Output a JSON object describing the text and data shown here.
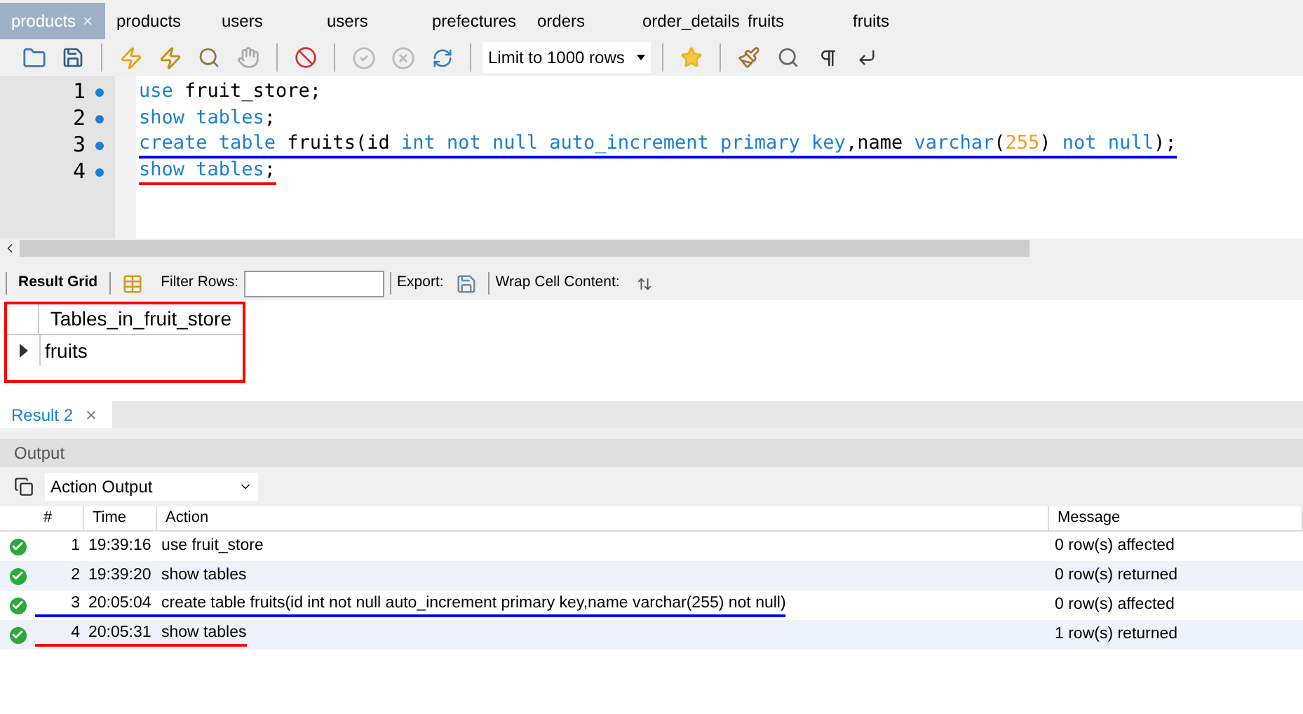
{
  "tabs": [
    {
      "label": "products",
      "selected": true,
      "closable": true
    },
    {
      "label": "products",
      "selected": false
    },
    {
      "label": "users",
      "selected": false
    },
    {
      "label": "users",
      "selected": false
    },
    {
      "label": "prefectures",
      "selected": false
    },
    {
      "label": "orders",
      "selected": false
    },
    {
      "label": "order_details",
      "selected": false
    },
    {
      "label": "fruits",
      "selected": false
    },
    {
      "label": "fruits",
      "selected": false
    }
  ],
  "toolbar": {
    "limit_select": "Limit to 1000 rows"
  },
  "editor": {
    "lines": [
      {
        "number": "1",
        "tokens": [
          {
            "text": "use",
            "kind": "keyword"
          },
          {
            "text": " fruit_store;",
            "kind": "plain"
          }
        ]
      },
      {
        "number": "2",
        "tokens": [
          {
            "text": "show tables",
            "kind": "keyword"
          },
          {
            "text": ";",
            "kind": "plain"
          }
        ]
      },
      {
        "number": "3",
        "color": "#0000ff",
        "tokens": [
          {
            "text": "create table",
            "kind": "keyword"
          },
          {
            "text": " fruits(id ",
            "kind": "plain"
          },
          {
            "text": "int not null auto_increment primary key",
            "kind": "keyword"
          },
          {
            "text": ",name ",
            "kind": "plain"
          },
          {
            "text": "varchar",
            "kind": "keyword"
          },
          {
            "text": "(",
            "kind": "plain"
          },
          {
            "text": "255",
            "kind": "number"
          },
          {
            "text": ") ",
            "kind": "plain"
          },
          {
            "text": "not null",
            "kind": "keyword"
          },
          {
            "text": ");",
            "kind": "plain"
          }
        ]
      },
      {
        "number": "4",
        "color": "#ff0000",
        "tokens": [
          {
            "text": "show tables",
            "kind": "keyword"
          },
          {
            "text": ";",
            "kind": "plain"
          }
        ]
      }
    ]
  },
  "result_toolbar": {
    "result_grid": "Result Grid",
    "filter_label": "Filter Rows:",
    "export_label": "Export:",
    "wrap_label": "Wrap Cell Content:"
  },
  "result_grid": {
    "color": "#ff0000",
    "column": "Tables_in_fruit_store",
    "rows": [
      {
        "value": "fruits",
        "selected": true
      }
    ]
  },
  "result_tabs": [
    {
      "label": "Result 2",
      "selected": true
    }
  ],
  "output": {
    "title": "Output",
    "mode": "Action Output",
    "columns": [
      "#",
      "Time",
      "Action",
      "Message"
    ],
    "rows": [
      {
        "kind": "success",
        "number": "1",
        "time": "19:39:16",
        "action": "use fruit_store",
        "message": "0 row(s) affected"
      },
      {
        "kind": "success",
        "number": "2",
        "time": "19:39:20",
        "action": "show tables",
        "message": "0 row(s) returned"
      },
      {
        "kind": "success",
        "number": "3",
        "time": "20:05:04",
        "action": "create table fruits(id int not null auto_increment primary key,name varchar(255) not null)",
        "message": "0 row(s) affected",
        "color": "#0000ff"
      },
      {
        "kind": "success",
        "number": "4",
        "time": "20:05:31",
        "action": "show tables",
        "message": "1 row(s) returned",
        "color": "#ff0000"
      }
    ]
  }
}
